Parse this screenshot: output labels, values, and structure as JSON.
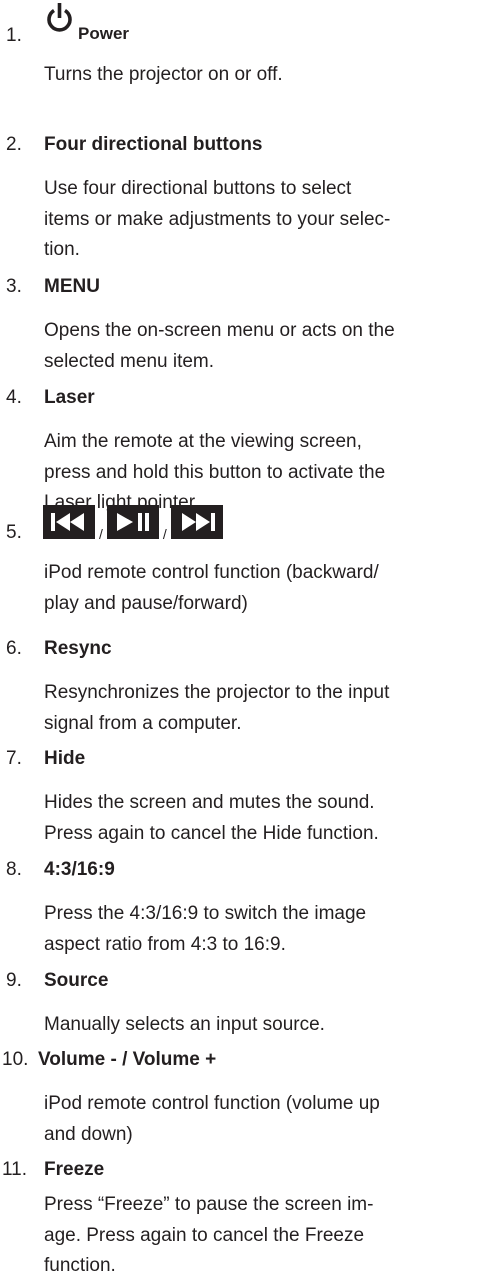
{
  "items": [
    {
      "number": "1.",
      "title": "Power",
      "description": "Turns the projector on or off.",
      "icon": "power-icon"
    },
    {
      "number": "2.",
      "title": "Four directional buttons",
      "description": "Use four directional buttons to select\nitems or make adjustments to your selec-\ntion."
    },
    {
      "number": "3.",
      "title": "MENU",
      "description": "Opens the on-screen menu or acts on the\nselected menu item."
    },
    {
      "number": "4.",
      "title": "Laser",
      "description": "Aim the remote at the viewing screen,\npress and hold this button to activate the\nLaser light pointer."
    },
    {
      "number": "5.",
      "icons": [
        "skip-backward-icon",
        "play-pause-icon",
        "skip-forward-icon"
      ],
      "separator": "/",
      "description": "iPod remote control function (backward/\nplay and pause/forward)"
    },
    {
      "number": "6.",
      "title": "Resync",
      "description": "Resynchronizes the projector to the input\nsignal from a computer."
    },
    {
      "number": "7.",
      "title": "Hide",
      "description": "Hides the screen and mutes the sound.\nPress again to cancel the Hide function."
    },
    {
      "number": "8.",
      "title": "4:3/16:9",
      "description": "Press the 4:3/16:9 to switch the image\naspect ratio from 4:3 to 16:9."
    },
    {
      "number": "9.",
      "title": "Source",
      "description": "Manually selects an input source."
    },
    {
      "number": "10.",
      "title": "Volume - / Volume +",
      "description": "iPod remote control function (volume up\nand down)"
    },
    {
      "number": "11.",
      "title": "Freeze",
      "description": "Press “Freeze” to pause the screen im-\nage. Press again to cancel the Freeze\nfunction."
    }
  ]
}
